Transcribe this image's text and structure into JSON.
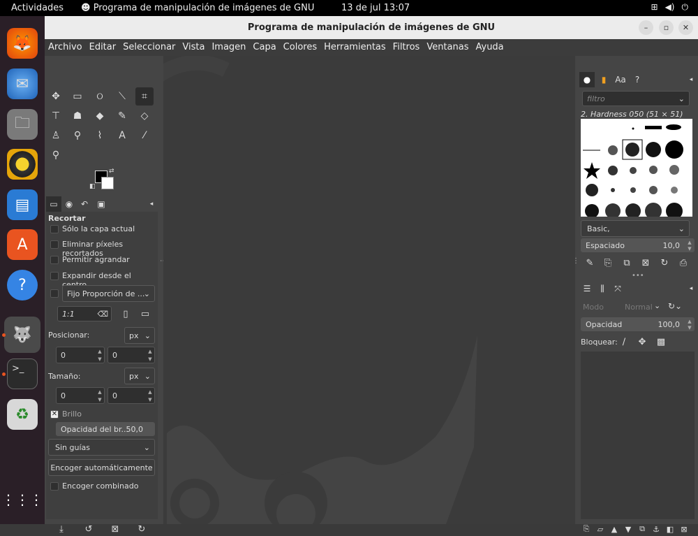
{
  "topbar": {
    "activities": "Actividades",
    "app_name": "Programa de manipulación de imágenes de GNU",
    "clock": "13 de jul  13:07"
  },
  "window": {
    "title": "Programa de manipulación de imágenes de GNU"
  },
  "menu": [
    "Archivo",
    "Editar",
    "Seleccionar",
    "Vista",
    "Imagen",
    "Capa",
    "Colores",
    "Herramientas",
    "Filtros",
    "Ventanas",
    "Ayuda"
  ],
  "tool_options": {
    "title": "Recortar",
    "only_layer": "Sólo la capa actual",
    "delete_pixels": "Eliminar píxeles recortados",
    "allow_growing": "Permitir agrandar",
    "expand_center": "Expandir desde el centro",
    "fixed": "Fijo Proporción de ...",
    "ratio": "1:1",
    "position_label": "Posicionar:",
    "size_label": "Tamaño:",
    "unit": "px",
    "pos_x": "0",
    "pos_y": "0",
    "size_w": "0",
    "size_h": "0",
    "highlight": "Brillo",
    "highlight_opacity_label": "Opacidad del br...",
    "highlight_opacity_value": "50,0",
    "guides": "Sin guías",
    "auto_shrink": "Encoger automáticamente",
    "shrink_merged": "Encoger combinado"
  },
  "brushes": {
    "filter_placeholder": "filtro",
    "current": "2. Hardness 050 (51 × 51)",
    "preset": "Basic,",
    "spacing_label": "Espaciado",
    "spacing_value": "10,0"
  },
  "layers": {
    "mode_label": "Modo",
    "mode_value": "Normal",
    "opacity_label": "Opacidad",
    "opacity_value": "100,0",
    "lock_label": "Bloquear:"
  }
}
